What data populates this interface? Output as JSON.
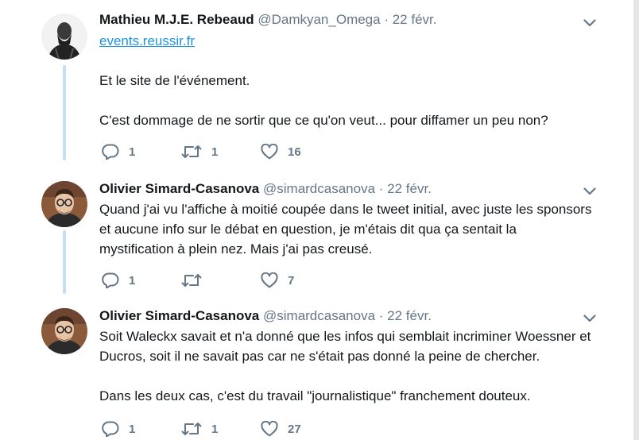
{
  "tweets": [
    {
      "author_name": "Mathieu M.J.E. Rebeaud",
      "handle": "@Damkyan_Omega",
      "date": "· 22 févr.",
      "link_text": "events.reussir.fr",
      "paragraphs": [
        "Et le site de l'événement.",
        "C'est dommage de ne sortir que ce qu'on veut... pour diffamer un peu non?"
      ],
      "replies": "1",
      "retweets": "1",
      "likes": "16"
    },
    {
      "author_name": "Olivier Simard-Casanova",
      "handle": "@simardcasanova",
      "date": "· 22 févr.",
      "paragraphs": [
        "Quand j'ai vu l'affiche à moitié coupée dans le tweet initial, avec juste les sponsors et aucune info sur le débat en question, je m'étais dit qua ça sentait la mystification à plein nez. Mais j'ai pas creusé."
      ],
      "replies": "1",
      "retweets": "",
      "likes": "7"
    },
    {
      "author_name": "Olivier Simard-Casanova",
      "handle": "@simardcasanova",
      "date": "· 22 févr.",
      "paragraphs": [
        "Soit Waleckx savait et n'a donné que les infos qui semblait incriminer Woessner et Ducros, soit il ne savait pas car ne s'était pas donné la peine de chercher.",
        "Dans les deux cas, c'est du travail \"journalistique\" franchement douteux."
      ],
      "replies": "1",
      "retweets": "1",
      "likes": "27"
    }
  ],
  "icons": {
    "reply": "reply-icon",
    "retweet": "retweet-icon",
    "like": "heart-icon",
    "menu": "chevron-down-icon"
  },
  "colors": {
    "thread_line": "#c4dff2",
    "link": "#1b95e0",
    "muted": "#657786",
    "text": "#14171a"
  }
}
